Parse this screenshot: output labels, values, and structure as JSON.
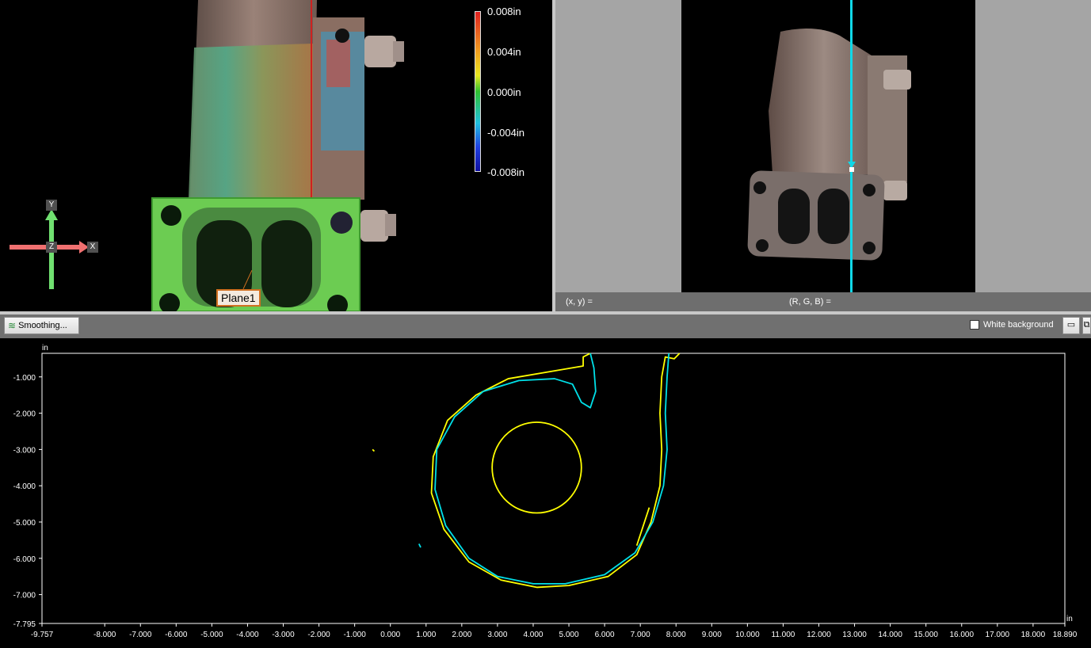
{
  "viewport3d": {
    "legend": {
      "labels": [
        "0.008in",
        "0.004in",
        "0.000in",
        "-0.004in",
        "-0.008in"
      ],
      "colors": [
        "#e02020",
        "#f0a020",
        "#e8e820",
        "#30c030",
        "#20c0e0",
        "#2040e0",
        "#1010a0"
      ]
    },
    "plane_label": "Plane1",
    "axes": {
      "y": "Y",
      "z": "Z",
      "x": "X"
    }
  },
  "viewport2d": {
    "status": {
      "xy": "(x, y)  =",
      "rgb": "(R, G, B)  ="
    }
  },
  "toolbar": {
    "smoothing_label": "Smoothing...",
    "white_background_label": "White background",
    "white_background_checked": false,
    "minimize_icon": "minimize-icon",
    "restore_icon": "restore-icon"
  },
  "chart_data": {
    "type": "line",
    "xlabel": "in",
    "ylabel": "in",
    "xlim": [
      -9.757,
      18.89
    ],
    "ylim": [
      -7.795,
      -0.35
    ],
    "x_ticks": [
      "-9.757",
      "-8.000",
      "-7.000",
      "-6.000",
      "-5.000",
      "-4.000",
      "-3.000",
      "-2.000",
      "-1.000",
      "0.000",
      "1.000",
      "2.000",
      "3.000",
      "4.000",
      "5.000",
      "6.000",
      "7.000",
      "8.000",
      "9.000",
      "10.000",
      "11.000",
      "12.000",
      "13.000",
      "14.000",
      "15.000",
      "16.000",
      "17.000",
      "18.000",
      "18.890"
    ],
    "y_ticks": [
      "-1.000",
      "-2.000",
      "-3.000",
      "-4.000",
      "-5.000",
      "-6.000",
      "-7.000",
      "-7.795"
    ],
    "grid": false,
    "series": [
      {
        "color": "#ffff00",
        "paths": [
          [
            [
              8.1,
              -0.35
            ],
            [
              7.95,
              -0.5
            ],
            [
              7.7,
              -0.45
            ],
            [
              7.6,
              -1.0
            ],
            [
              7.55,
              -2.0
            ],
            [
              7.6,
              -3.0
            ],
            [
              7.55,
              -4.0
            ],
            [
              7.3,
              -5.0
            ],
            [
              6.9,
              -5.9
            ],
            [
              6.1,
              -6.5
            ],
            [
              5.0,
              -6.75
            ],
            [
              4.1,
              -6.8
            ],
            [
              3.1,
              -6.6
            ],
            [
              2.2,
              -6.1
            ],
            [
              1.5,
              -5.2
            ],
            [
              1.15,
              -4.2
            ],
            [
              1.2,
              -3.2
            ],
            [
              1.6,
              -2.2
            ],
            [
              2.4,
              -1.5
            ],
            [
              3.3,
              -1.05
            ],
            [
              4.5,
              -0.85
            ],
            [
              5.4,
              -0.7
            ],
            [
              5.4,
              -0.45
            ],
            [
              5.6,
              -0.35
            ]
          ],
          [
            [
              6.9,
              -5.65
            ],
            [
              7.25,
              -4.6
            ]
          ],
          [
            [
              -0.5,
              -3.0
            ],
            [
              -0.45,
              -3.05
            ]
          ]
        ]
      },
      {
        "color": "#ffff00",
        "circle": {
          "cx": 4.1,
          "cy": -3.5,
          "r": 1.25
        }
      },
      {
        "color": "#00e0e8",
        "paths": [
          [
            [
              7.8,
              -0.35
            ],
            [
              7.75,
              -1.0
            ],
            [
              7.7,
              -2.0
            ],
            [
              7.75,
              -3.0
            ],
            [
              7.65,
              -4.0
            ],
            [
              7.35,
              -5.0
            ],
            [
              6.85,
              -5.85
            ],
            [
              6.0,
              -6.45
            ],
            [
              4.9,
              -6.7
            ],
            [
              4.0,
              -6.7
            ],
            [
              3.0,
              -6.5
            ],
            [
              2.2,
              -6.0
            ],
            [
              1.55,
              -5.1
            ],
            [
              1.25,
              -4.1
            ],
            [
              1.3,
              -3.0
            ],
            [
              1.8,
              -2.1
            ],
            [
              2.6,
              -1.4
            ],
            [
              3.6,
              -1.1
            ],
            [
              4.6,
              -1.05
            ],
            [
              5.1,
              -1.2
            ],
            [
              5.35,
              -1.7
            ],
            [
              5.6,
              -1.85
            ],
            [
              5.75,
              -1.4
            ],
            [
              5.7,
              -0.75
            ],
            [
              5.6,
              -0.35
            ]
          ],
          [
            [
              0.8,
              -5.6
            ],
            [
              0.85,
              -5.7
            ]
          ]
        ]
      }
    ]
  }
}
